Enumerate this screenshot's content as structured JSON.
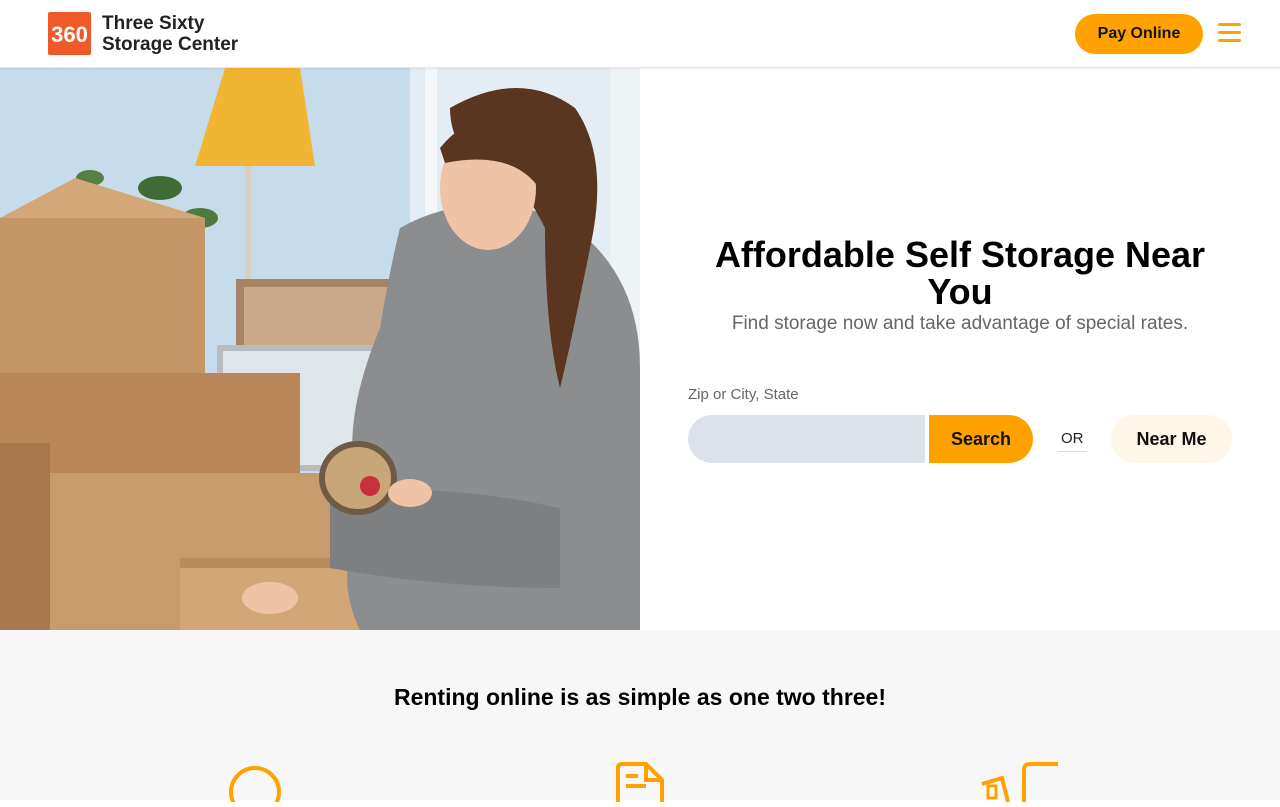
{
  "header": {
    "brand_line1": "Three Sixty",
    "brand_line2": "Storage Center",
    "logo_text": "360",
    "pay_label": "Pay Online",
    "menu_icon": "hamburger-icon",
    "accent_color": "#ffa200",
    "logo_color": "#f05a28"
  },
  "hero": {
    "title": "Affordable Self Storage Near You",
    "subtitle": "Find storage now and take advantage of special rates.",
    "search_label": "Zip or City, State",
    "search_value": "",
    "search_button": "Search",
    "or_text": "OR",
    "near_button": "Near Me"
  },
  "steps": {
    "title": "Renting online is as simple as one two three!",
    "icons": [
      "search-icon",
      "document-icon",
      "moving-boxes-icon"
    ]
  }
}
